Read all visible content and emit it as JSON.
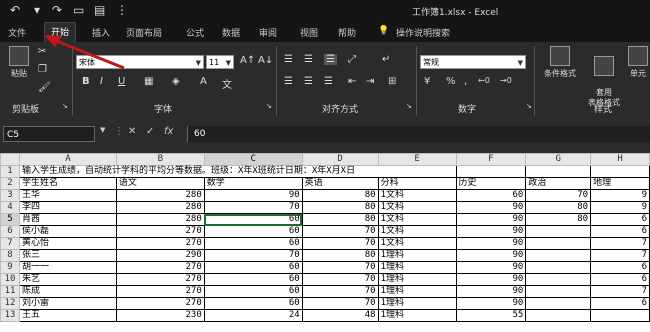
{
  "window": {
    "title": "工作簿1.xlsx  -  Excel"
  },
  "tabs": [
    "文件",
    "开始",
    "插入",
    "页面布局",
    "公式",
    "数据",
    "审阅",
    "视图",
    "帮助"
  ],
  "active_tab": "开始",
  "tell_me": "操作说明搜索",
  "ribbon": {
    "paste": "粘贴",
    "clipboard": "剪贴板",
    "font_name": "宋体",
    "font_size": "11",
    "font_group": "字体",
    "align_group": "对齐方式",
    "number_format": "常规",
    "number_group": "数字",
    "cond_format": "条件格式",
    "table_format": "套用\n表格格式",
    "cell_styles": "单元",
    "style_group": "样式",
    "bold": "B",
    "italic": "I",
    "underline": "U",
    "percent": "%",
    "comma": ","
  },
  "formula_bar": {
    "name_box": "C5",
    "cancel": "✕",
    "enter": "✓",
    "fx": "fx",
    "value": "60"
  },
  "columns": [
    "A",
    "B",
    "C",
    "D",
    "E",
    "F",
    "G",
    "H"
  ],
  "selected_col": "C",
  "selected_row": "5",
  "title_row": "输入学生成绩，自动统计学科的平均分等数据。班级：X年X班统计日期：X年X月X日",
  "headers": [
    "学生姓名",
    "语文",
    "数学",
    "英语",
    "分科",
    "历史",
    "政治",
    "地理"
  ],
  "rows": [
    [
      "3",
      "王华",
      "280",
      "90",
      "80",
      "1文科",
      "60",
      "70",
      "9"
    ],
    [
      "4",
      "李四",
      "280",
      "70",
      "80",
      "1文科",
      "90",
      "80",
      "9"
    ],
    [
      "5",
      "肖茜",
      "280",
      "60",
      "80",
      "1文科",
      "90",
      "80",
      "6"
    ],
    [
      "6",
      "侯小磊",
      "270",
      "60",
      "70",
      "1文科",
      "90",
      "",
      "6"
    ],
    [
      "7",
      "黄心怡",
      "270",
      "60",
      "70",
      "1文科",
      "90",
      "",
      "7"
    ],
    [
      "8",
      "张三",
      "290",
      "70",
      "80",
      "1理科",
      "90",
      "",
      "7"
    ],
    [
      "9",
      "胡一一",
      "270",
      "60",
      "70",
      "1理科",
      "90",
      "",
      "6"
    ],
    [
      "10",
      "朱艺",
      "270",
      "60",
      "70",
      "1理科",
      "90",
      "",
      "6"
    ],
    [
      "11",
      "陈成",
      "270",
      "60",
      "70",
      "1理科",
      "90",
      "",
      "7"
    ],
    [
      "12",
      "刘小雷",
      "270",
      "60",
      "70",
      "1理科",
      "90",
      "",
      "6"
    ],
    [
      "13",
      "王五",
      "230",
      "24",
      "48",
      "1理科",
      "55",
      "",
      ""
    ]
  ],
  "colors": {
    "dark": "#2b2b2b",
    "selection": "#1e6b2e",
    "arrow": "#c0171c"
  }
}
